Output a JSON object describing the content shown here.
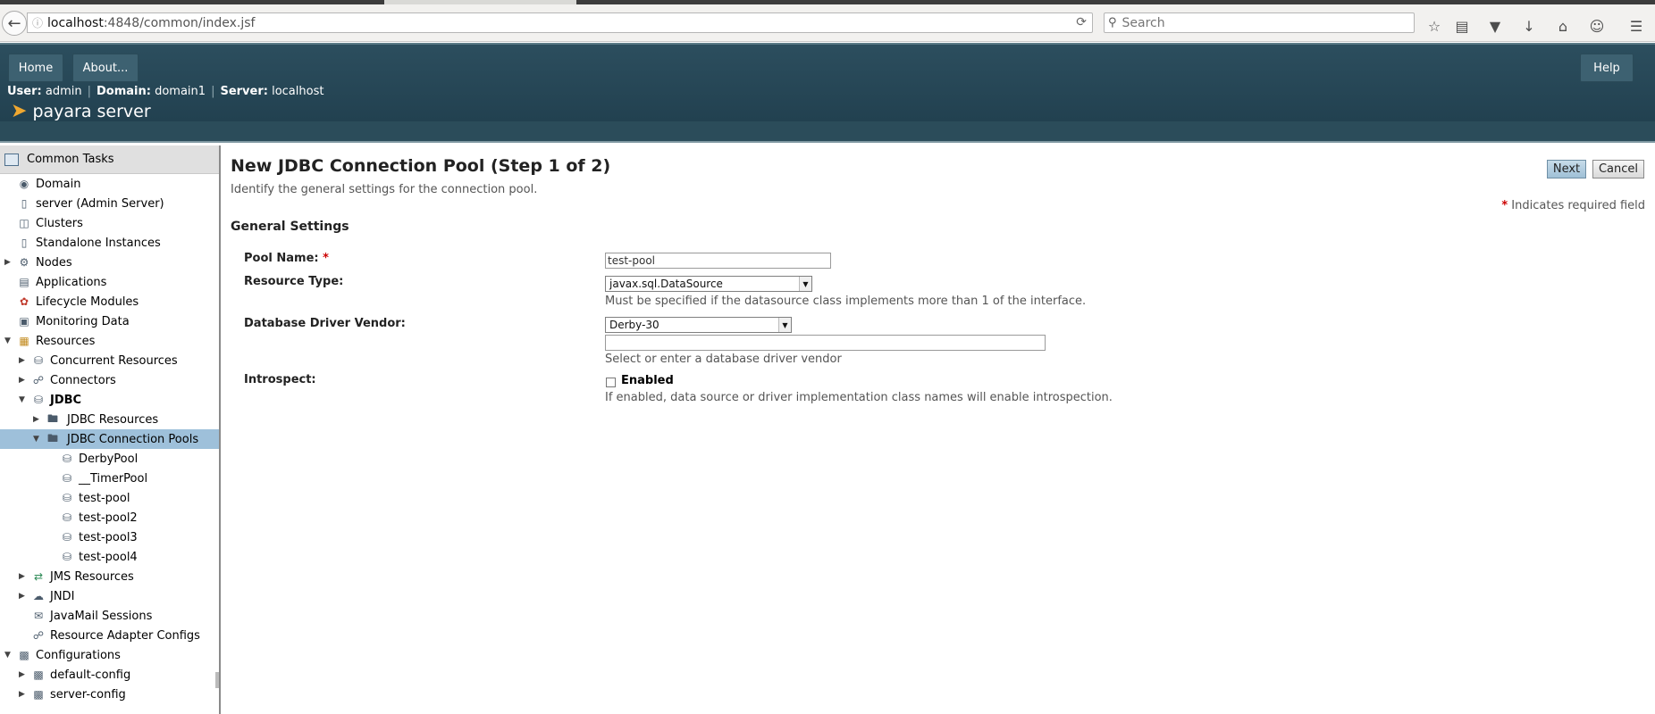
{
  "browser": {
    "url_host": "localhost",
    "url_rest": ":4848/common/index.jsf",
    "search_placeholder": "Search"
  },
  "masthead": {
    "home_label": "Home",
    "about_label": "About...",
    "help_label": "Help",
    "user_label": "User:",
    "user_value": "admin",
    "domain_label": "Domain:",
    "domain_value": "domain1",
    "server_label": "Server:",
    "server_value": "localhost",
    "logo_text": "payara server",
    "accent_color": "#f0a830"
  },
  "sidebar": {
    "header": "Common Tasks",
    "items": [
      {
        "label": "Domain",
        "icon": "globe-icon"
      },
      {
        "label": "server (Admin Server)",
        "icon": "server-icon"
      },
      {
        "label": "Clusters",
        "icon": "cluster-icon"
      },
      {
        "label": "Standalone Instances",
        "icon": "server-icon"
      },
      {
        "label": "Nodes",
        "icon": "nodes-icon"
      },
      {
        "label": "Applications",
        "icon": "window-icon"
      },
      {
        "label": "Lifecycle Modules",
        "icon": "gears-icon"
      },
      {
        "label": "Monitoring Data",
        "icon": "monitor-icon"
      },
      {
        "label": "Resources",
        "icon": "resources-icon"
      },
      {
        "label": "Concurrent Resources",
        "icon": "database-icon"
      },
      {
        "label": "Connectors",
        "icon": "connector-icon"
      },
      {
        "label": "JDBC",
        "icon": "database-icon"
      },
      {
        "label": "JDBC Resources",
        "icon": "folder-icon"
      },
      {
        "label": "JDBC Connection Pools",
        "icon": "folder-icon"
      },
      {
        "label": "DerbyPool",
        "icon": "database-icon"
      },
      {
        "label": "__TimerPool",
        "icon": "database-icon"
      },
      {
        "label": "test-pool",
        "icon": "database-icon"
      },
      {
        "label": "test-pool2",
        "icon": "database-icon"
      },
      {
        "label": "test-pool3",
        "icon": "database-icon"
      },
      {
        "label": "test-pool4",
        "icon": "database-icon"
      },
      {
        "label": "JMS Resources",
        "icon": "jms-icon"
      },
      {
        "label": "JNDI",
        "icon": "jndi-icon"
      },
      {
        "label": "JavaMail Sessions",
        "icon": "mail-icon"
      },
      {
        "label": "Resource Adapter Configs",
        "icon": "connector-icon"
      },
      {
        "label": "Configurations",
        "icon": "config-icon"
      },
      {
        "label": "default-config",
        "icon": "config-icon"
      },
      {
        "label": "server-config",
        "icon": "config-icon"
      }
    ]
  },
  "main": {
    "title": "New JDBC Connection Pool (Step 1 of 2)",
    "subtitle": "Identify the general settings for the connection pool.",
    "next_label": "Next",
    "cancel_label": "Cancel",
    "required_star": "*",
    "required_note": "Indicates required field",
    "section_title": "General Settings",
    "pool_name_label": "Pool Name:",
    "pool_name_value": "test-pool",
    "resource_type_label": "Resource Type:",
    "resource_type_value": "javax.sql.DataSource",
    "resource_type_help": "Must be specified if the datasource class implements more than 1 of the interface.",
    "vendor_label": "Database Driver Vendor:",
    "vendor_value": "Derby-30",
    "vendor_custom_value": "",
    "vendor_help": "Select or enter a database driver vendor",
    "introspect_label": "Introspect:",
    "introspect_checkbox_label": "Enabled",
    "introspect_checked": false,
    "introspect_help": "If enabled, data source or driver implementation class names will enable introspection."
  }
}
